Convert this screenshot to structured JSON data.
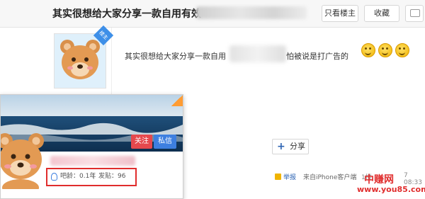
{
  "thread": {
    "title": "其实很想给大家分享一款自用有效"
  },
  "toolbar": {
    "only_op_label": "只看楼主",
    "favorite_label": "收藏"
  },
  "post": {
    "op_badge": "楼主",
    "text_before": "其实很想给大家分享一款自用",
    "text_after": "怕被说是打广告的",
    "share_label": "分享"
  },
  "footer": {
    "report_label": "举报",
    "source_label": "来自iPhone客户端",
    "floor_label": "1楼",
    "time_label": "7 08:33"
  },
  "card": {
    "follow_label": "关注",
    "message_label": "私信",
    "age_label": "吧龄：0.1年",
    "separator": "|",
    "posts_label": "发贴：96"
  },
  "watermark": {
    "logo_text": "中赚网",
    "url_text": "www.you85.com"
  },
  "colors": {
    "follow_button": "#e5484d",
    "message_button": "#3d7fe0",
    "op_badge": "#3d8fe8",
    "highlight_box": "#e02d2d",
    "share_plus": "#2d64b3"
  }
}
